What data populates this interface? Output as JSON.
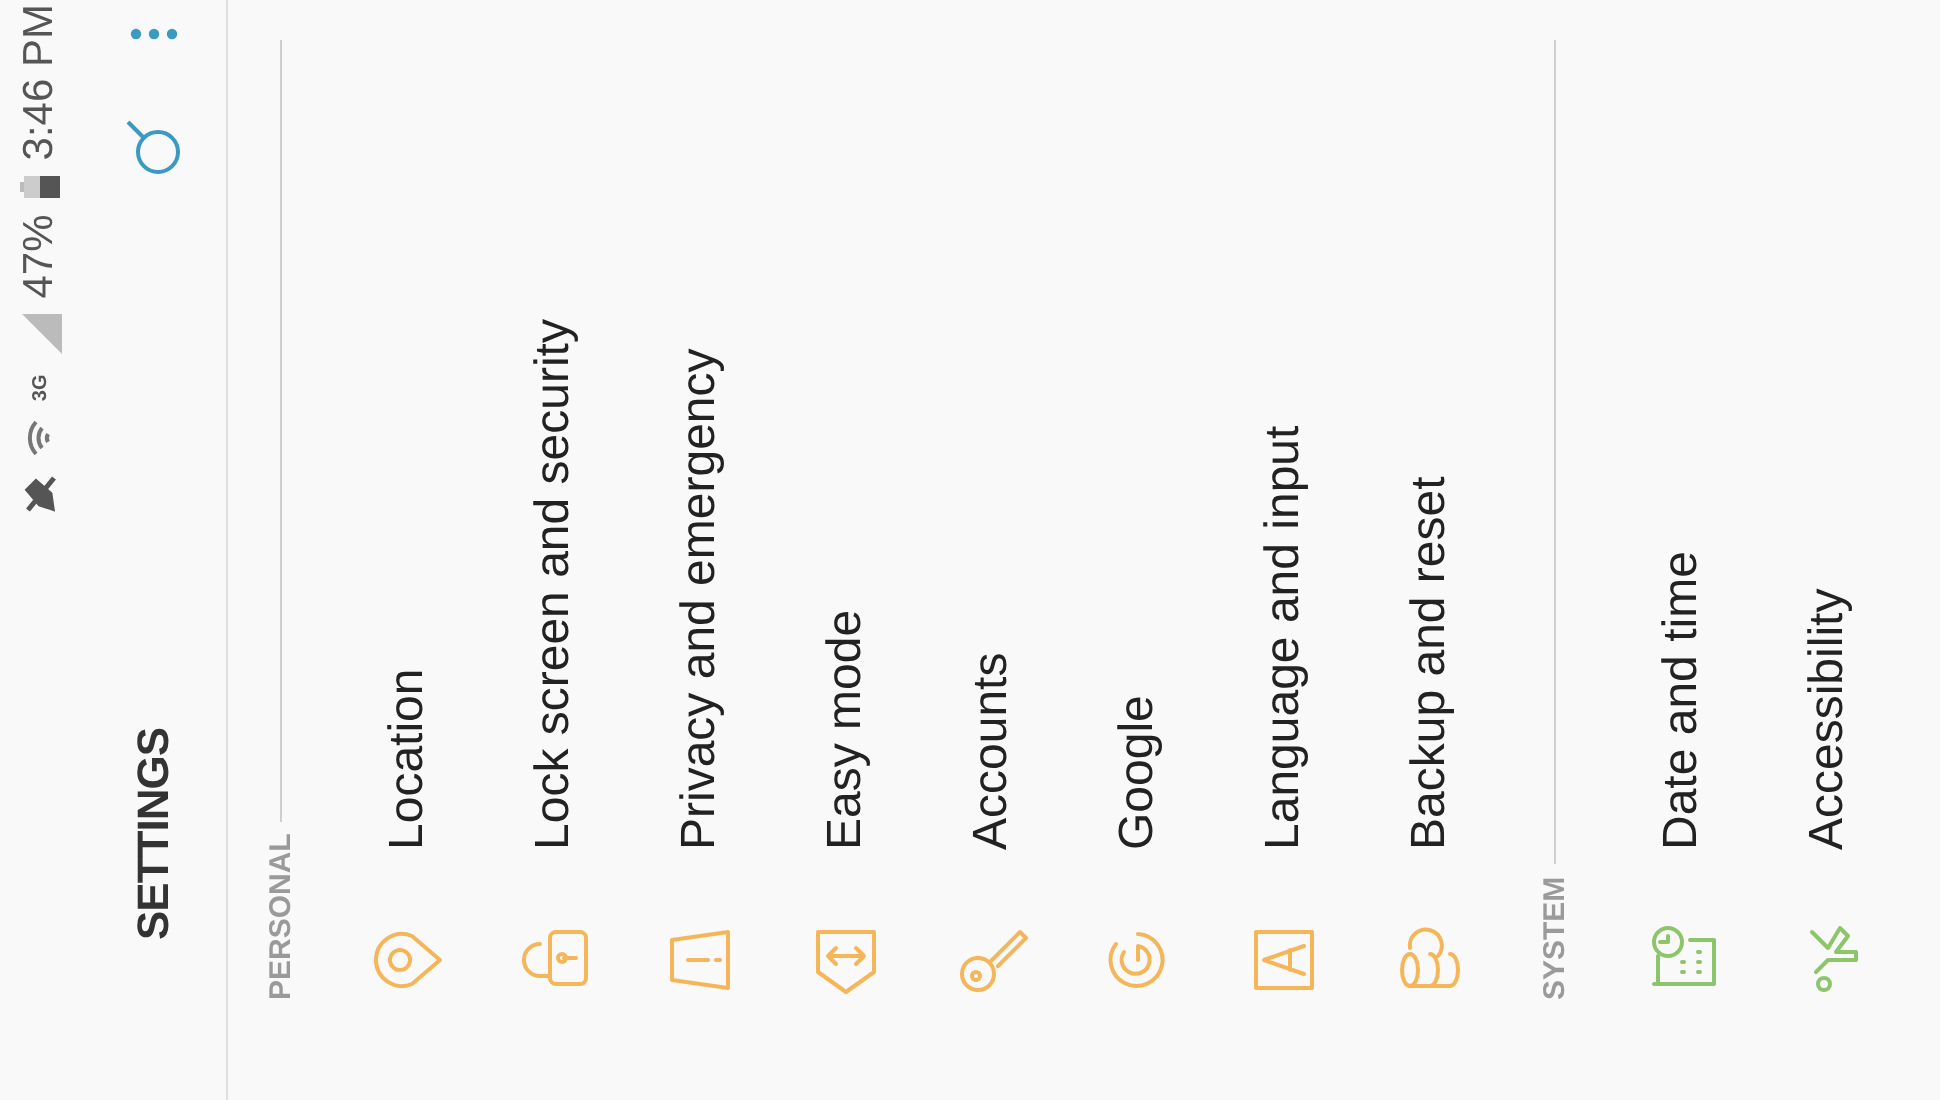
{
  "status_bar": {
    "signal_type": "3G",
    "battery": "47%",
    "time": "3:46 PM"
  },
  "app_bar": {
    "title": "SETTINGS"
  },
  "sections": [
    {
      "title": "PERSONAL",
      "color": "#f5b65a",
      "items": [
        {
          "label": "Location"
        },
        {
          "label": "Lock screen and security"
        },
        {
          "label": "Privacy and emergency"
        },
        {
          "label": "Easy mode"
        },
        {
          "label": "Accounts"
        },
        {
          "label": "Google"
        },
        {
          "label": "Language and input"
        },
        {
          "label": "Backup and reset"
        }
      ]
    },
    {
      "title": "SYSTEM",
      "color": "#8cc56a",
      "items": [
        {
          "label": "Date and time"
        },
        {
          "label": "Accessibility"
        }
      ]
    }
  ]
}
